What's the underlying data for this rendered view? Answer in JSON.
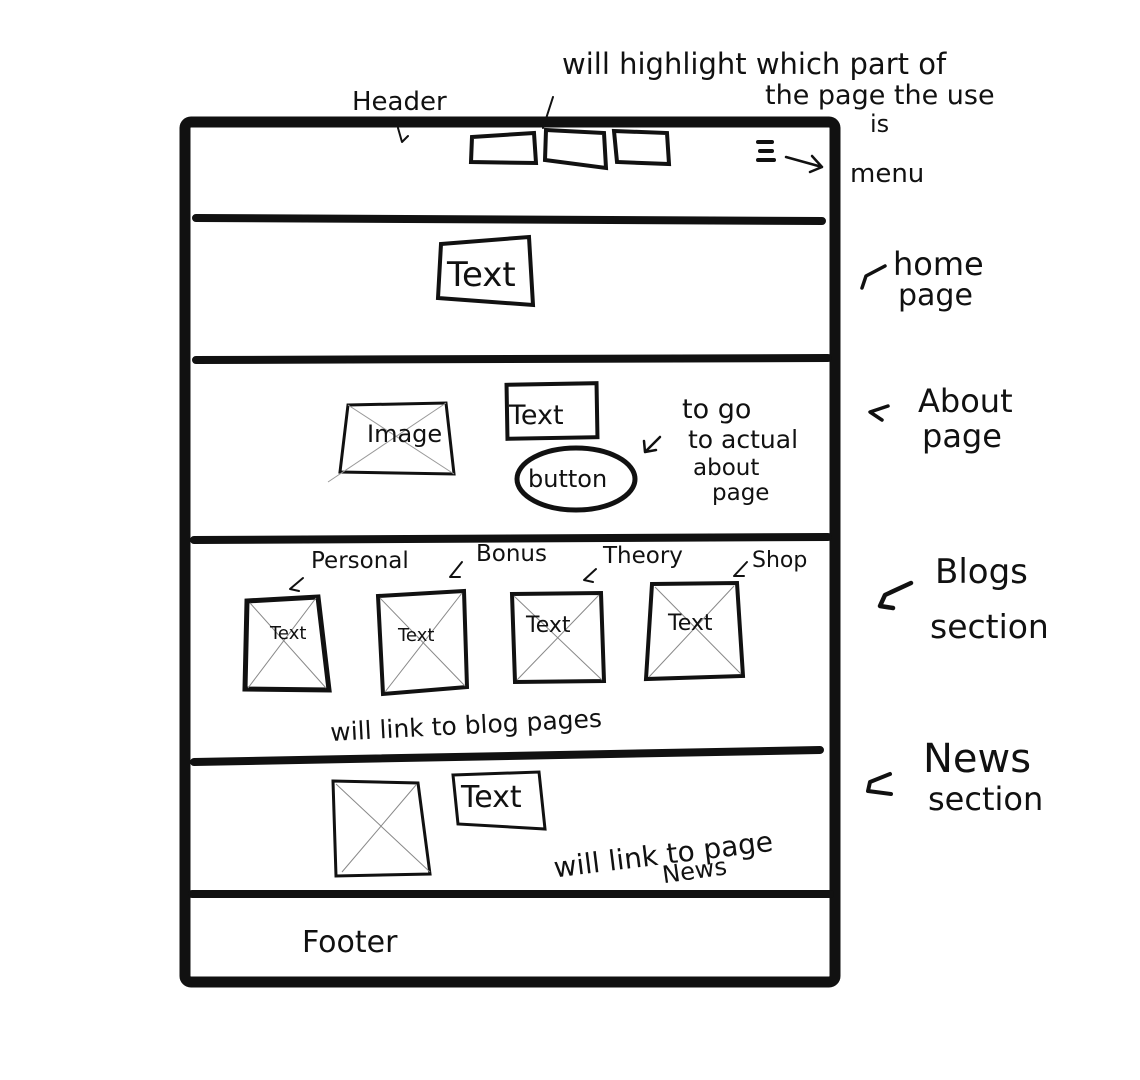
{
  "annotations": {
    "header": "Header",
    "nav_note_line1": "will highlight which part of",
    "nav_note_line2": "the page the use",
    "nav_note_line3": "is",
    "menu": "menu",
    "home_page_line1": "home",
    "home_page_line2": "page",
    "about_page_line1": "About",
    "about_page_line2": "page",
    "about_button_note_line1": "to go",
    "about_button_note_line2": "to actual",
    "about_button_note_line3": "about",
    "about_button_note_line4": "page",
    "blogs_section_line1": "Blogs",
    "blogs_section_line2": "section",
    "blogs_link_note": "will link to blog pages",
    "news_section_line1": "News",
    "news_section_line2": "section",
    "news_link_note_line1": "will link to page",
    "news_link_note_line2": "News",
    "footer": "Footer"
  },
  "home": {
    "text_label": "Text"
  },
  "about": {
    "image_label": "Image",
    "text_label": "Text",
    "button_label": "button"
  },
  "blogs": {
    "cards": [
      {
        "category": "Personal",
        "label": "Text"
      },
      {
        "category": "Bonus",
        "label": "Text"
      },
      {
        "category": "Theory",
        "label": "Text"
      },
      {
        "category": "Shop",
        "label": "Text"
      }
    ]
  },
  "news": {
    "text_label": "Text"
  }
}
